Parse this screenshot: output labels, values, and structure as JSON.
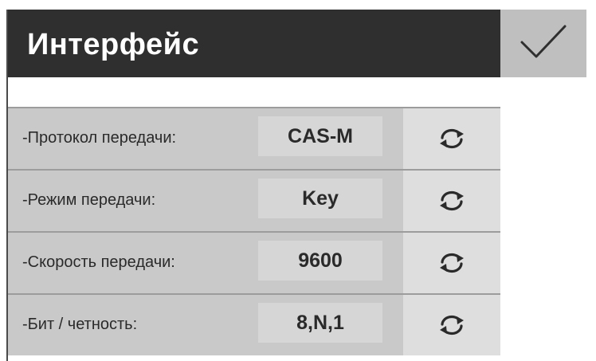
{
  "header": {
    "title": "Интерфейс",
    "confirm_icon": "check-icon"
  },
  "rows": [
    {
      "label": "-Протокол передачи:",
      "value": "CAS-M",
      "action_icon": "refresh-icon"
    },
    {
      "label": "-Режим передачи:",
      "value": "Key",
      "action_icon": "refresh-icon"
    },
    {
      "label": "-Скорость передачи:",
      "value": "9600",
      "action_icon": "refresh-icon"
    },
    {
      "label": "-Бит / четность:",
      "value": "8,N,1",
      "action_icon": "refresh-icon"
    }
  ],
  "colors": {
    "header_bg": "#2f2f2f",
    "confirm_bg": "#bfbfbf",
    "row_bg": "#c9c9c9",
    "value_bg": "#d6d6d6",
    "action_bg": "#dedede"
  }
}
